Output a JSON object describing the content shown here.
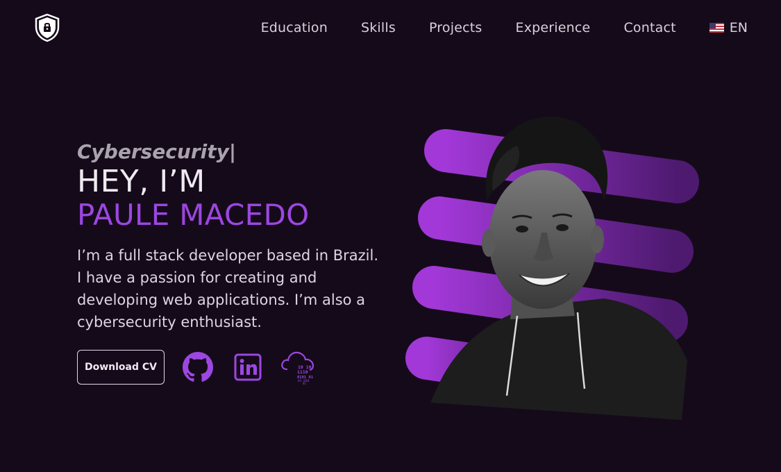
{
  "nav": {
    "logo_icon": "shield-lock-icon",
    "items": [
      "Education",
      "Skills",
      "Projects",
      "Experience",
      "Contact"
    ],
    "lang": {
      "label": "EN",
      "icon": "us-flag-icon"
    }
  },
  "hero": {
    "typed_text": "Cybersecurity",
    "cursor": "|",
    "greeting": "HEY, I’M",
    "name": "PAULE MACEDO",
    "bio": "I’m a full stack developer based in Brazil. I have a passion for creating and developing web applications. I’m also a cybersecurity enthusiast.",
    "download_label": "Download CV",
    "socials": [
      {
        "icon": "github-icon"
      },
      {
        "icon": "linkedin-icon"
      },
      {
        "icon": "cloud-binary-icon"
      }
    ]
  },
  "colors": {
    "background": "#150a1a",
    "accent": "#9c47e0",
    "stripe_start": "#a238d8",
    "stripe_end": "#4e1a70"
  }
}
